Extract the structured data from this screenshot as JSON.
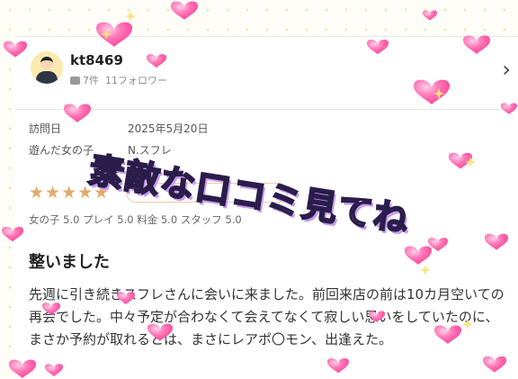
{
  "review": {
    "user": {
      "name": "kt8469",
      "post_count": "7件",
      "followers": "11フォロワー"
    },
    "visit_label": "訪問日",
    "visit_date": "2025年5月20日",
    "girl_label": "遊んだ女の子",
    "girl_name": "N.スフレ",
    "rating_stars": 5,
    "scores": "女の子 5.0 プレイ 5.0 料金 5.0 スタッフ 5.0",
    "title": "整いました",
    "body": "先週に引き続きスフレさんに会いに来ました。前回来店の前は10カ月空いての再会でした。中々予定が合わなくて会えてなくて寂しい思いをしていたのに、まさか予約が取れるとは、まさにレアポ〇モン、出逢えた。"
  },
  "overlay_text": "素敵な口コミ見てね",
  "colors": {
    "heart": "#ff5fa8",
    "heart_light": "#ff9fcf",
    "star": "#e3a96a",
    "overlay_shadow": "#c79cf0"
  },
  "icons": [
    "heart-icon",
    "chevron-right-icon",
    "comment-icon",
    "avatar-icon",
    "sparkle-icon"
  ]
}
